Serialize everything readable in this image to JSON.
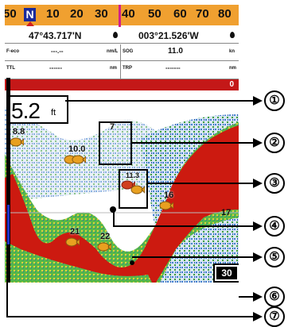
{
  "compass": {
    "ticks": [
      "50",
      "10",
      "20",
      "30",
      "40",
      "50",
      "60",
      "70",
      "80"
    ],
    "north": "N"
  },
  "position": {
    "lat": "47°43.717'N",
    "lon": "003°21.526'W"
  },
  "row1": {
    "f_eco_label": "F-eco",
    "f_eco_value": "---.--",
    "f_eco_unit": "nm/L",
    "sog_label": "SOG",
    "sog_value": "11.0",
    "sog_unit": "kn"
  },
  "row2": {
    "ttl_label": "TTL",
    "ttl_value": "------",
    "ttl_unit": "nm",
    "trp_label": "TRP",
    "trp_value": "-------",
    "trp_unit": "nm"
  },
  "depth_strip_value": "0",
  "depth": {
    "value": "5.2",
    "unit": "ft"
  },
  "fish": [
    {
      "depth": "8.8"
    },
    {
      "depth": "10.0"
    },
    {
      "depth": "7"
    },
    {
      "depth": "11.3"
    },
    {
      "depth": "16"
    },
    {
      "depth": "21"
    },
    {
      "depth": "22"
    }
  ],
  "range_label": "17",
  "zoom_value": "30",
  "callouts": [
    "①",
    "②",
    "③",
    "④",
    "⑤",
    "⑥",
    "⑦"
  ],
  "colors": {
    "compass": "#f0a030",
    "north_box": "#1a2a9a",
    "course_line": "#d0208a",
    "depth_strip": "#c41818",
    "sonar_red": "#cc1a10",
    "sonar_green": "#2a9a3a",
    "sonar_blue": "#2040c0",
    "fish": "#e8a020"
  }
}
